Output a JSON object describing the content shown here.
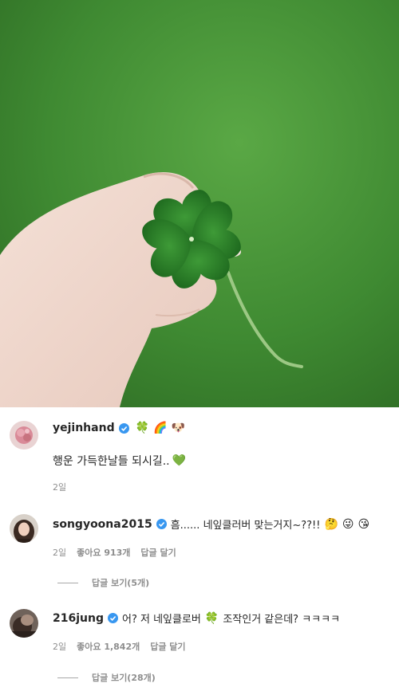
{
  "comments": [
    {
      "username": "yejinhand",
      "header_emojis": [
        "🍀",
        "🌈",
        "🐶"
      ],
      "text": "행운 가득한날들 되시길..",
      "text_emoji": "💚",
      "time": "2일"
    },
    {
      "username": "songyoona2015",
      "text": "흠...... 네잎클러버 맞는거지~??!!",
      "text_emojis": [
        "🤔",
        "😜",
        "😘"
      ],
      "time": "2일",
      "likes": "좋아요 913개",
      "reply_label": "답글 달기",
      "view_replies": "답글 보기(5개)"
    },
    {
      "username": "216jung",
      "text_before": "어? 저 네잎클로버",
      "text_emoji": "🍀",
      "text_after": " 조작인거 같은데? ㅋㅋㅋㅋ",
      "time": "2일",
      "likes": "좋아요 1,842개",
      "reply_label": "답글 달기",
      "view_replies": "답글 보기(28개)"
    }
  ],
  "colors": {
    "verified": "#3897f0",
    "meta_text": "#8e8e8e",
    "primary_text": "#262626",
    "clover_green": "#2f8a2a",
    "grass_green": "#3f8a32"
  },
  "icons": {
    "verified": "verified-badge-icon"
  }
}
